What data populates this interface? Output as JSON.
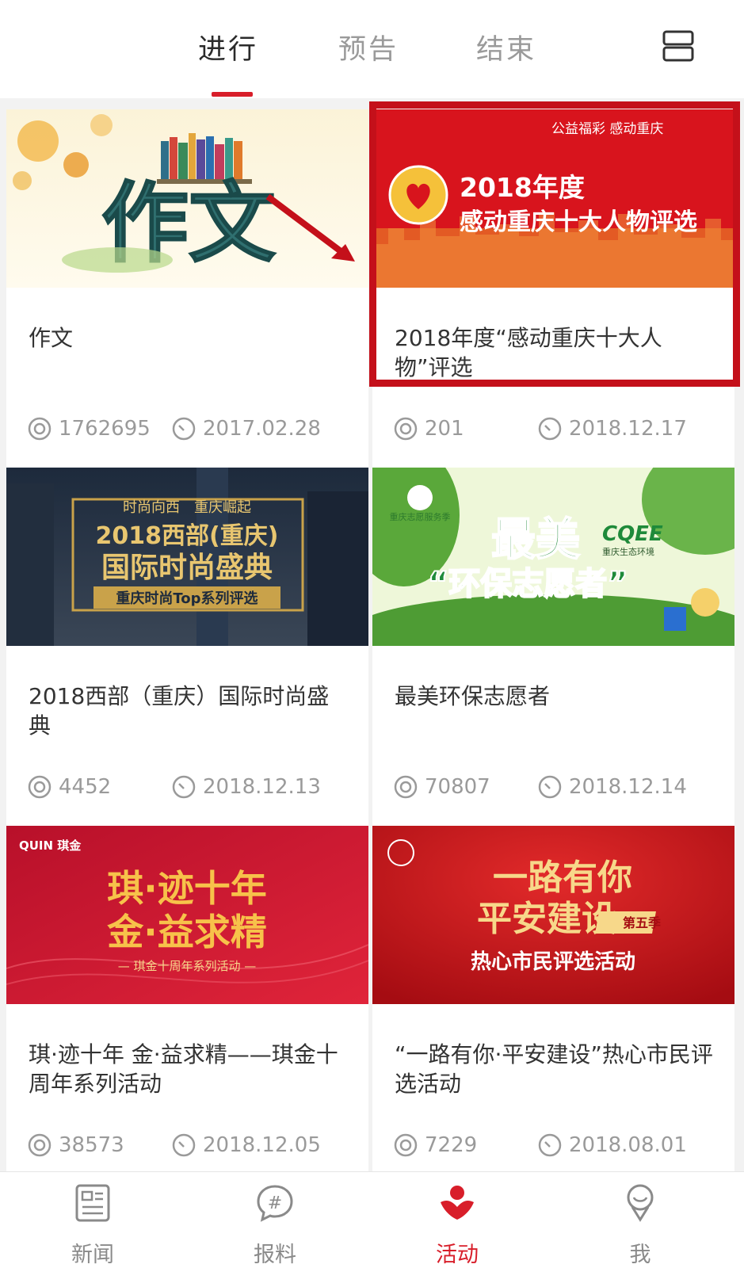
{
  "tabs": [
    {
      "label": "进行",
      "active": true
    },
    {
      "label": "预告",
      "active": false
    },
    {
      "label": "结束",
      "active": false
    }
  ],
  "cards": [
    {
      "title": "作文",
      "views": "1762695",
      "date": "2017.02.28",
      "banner": {
        "text": "作文"
      }
    },
    {
      "title": "2018年度“感动重庆十大人物”评选",
      "views": "201",
      "date": "2018.12.17",
      "banner": {
        "brand": "公益福彩 感动重庆",
        "line1": "2018年度",
        "line2": "感动重庆十大人物评选"
      }
    },
    {
      "title": "2018西部（重庆）国际时尚盛典",
      "views": "4452",
      "date": "2018.12.13",
      "banner": {
        "top": "时尚向西　重庆崛起",
        "line1": "2018西部(重庆)",
        "line2": "国际时尚盛典",
        "strip": "重庆时尚Top系列评选"
      }
    },
    {
      "title": "最美环保志愿者",
      "views": "70807",
      "date": "2018.12.14",
      "banner": {
        "line1": "最美",
        "line2": "“环保志愿者”",
        "badge": "重庆志愿服务季",
        "logo": "CQEE",
        "logo_sub": "重庆生态环境"
      }
    },
    {
      "title": "琪·迹十年 金·益求精——琪金十周年系列活动",
      "views": "38573",
      "date": "2018.12.05",
      "banner": {
        "brand": "QUIN 琪金",
        "line1": "琪·迹十年",
        "line2": "金·益求精",
        "strip": "— 琪金十周年系列活动 —"
      }
    },
    {
      "title": "“一路有你·平安建设”热心市民评选活动",
      "views": "7229",
      "date": "2018.08.01",
      "banner": {
        "line1": "一路有你",
        "line2": "平安建设",
        "badge": "第五季",
        "line3": "热心市民评选活动"
      }
    }
  ],
  "nav": [
    {
      "label": "新闻",
      "icon": "news-icon",
      "active": false
    },
    {
      "label": "报料",
      "icon": "hashtag-chat-icon",
      "active": false
    },
    {
      "label": "活动",
      "icon": "activity-icon",
      "active": true
    },
    {
      "label": "我",
      "icon": "profile-icon",
      "active": false
    }
  ],
  "colors": {
    "accent": "#d81e2a",
    "muted": "#9a9a9a",
    "highlight": "#c4101a"
  }
}
